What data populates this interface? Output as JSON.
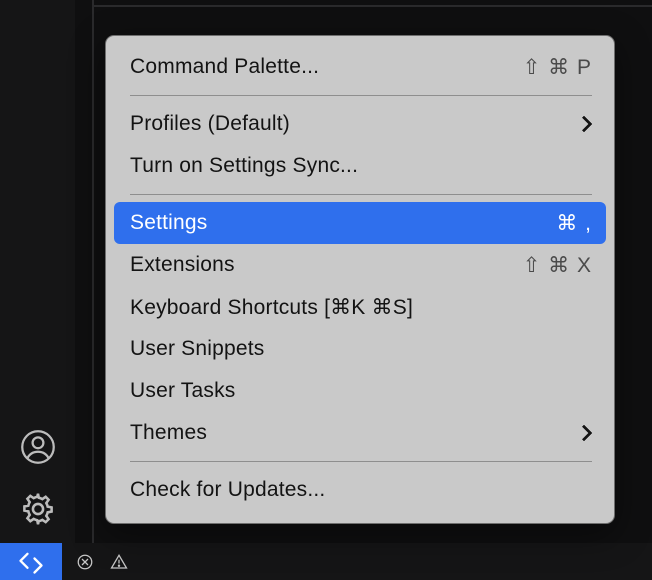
{
  "menu": {
    "commandPalette": {
      "label": "Command Palette...",
      "shortcut": "⇧ ⌘ P"
    },
    "profiles": {
      "label": "Profiles (Default)"
    },
    "settingsSync": {
      "label": "Turn on Settings Sync..."
    },
    "settings": {
      "label": "Settings",
      "shortcut": "⌘ ,"
    },
    "extensions": {
      "label": "Extensions",
      "shortcut": "⇧ ⌘ X"
    },
    "keyboardShortcuts": {
      "label": "Keyboard Shortcuts [⌘K ⌘S]"
    },
    "userSnippets": {
      "label": "User Snippets"
    },
    "userTasks": {
      "label": "User Tasks"
    },
    "themes": {
      "label": "Themes"
    },
    "checkUpdates": {
      "label": "Check for Updates..."
    }
  },
  "activityBar": {
    "accounts": "accounts-icon",
    "manage": "gear-icon"
  },
  "statusBar": {
    "remote": "remote-icon"
  },
  "colors": {
    "selection": "#2f6fed",
    "menuBg": "#c9c9c9",
    "appBg": "#0f0f10"
  }
}
